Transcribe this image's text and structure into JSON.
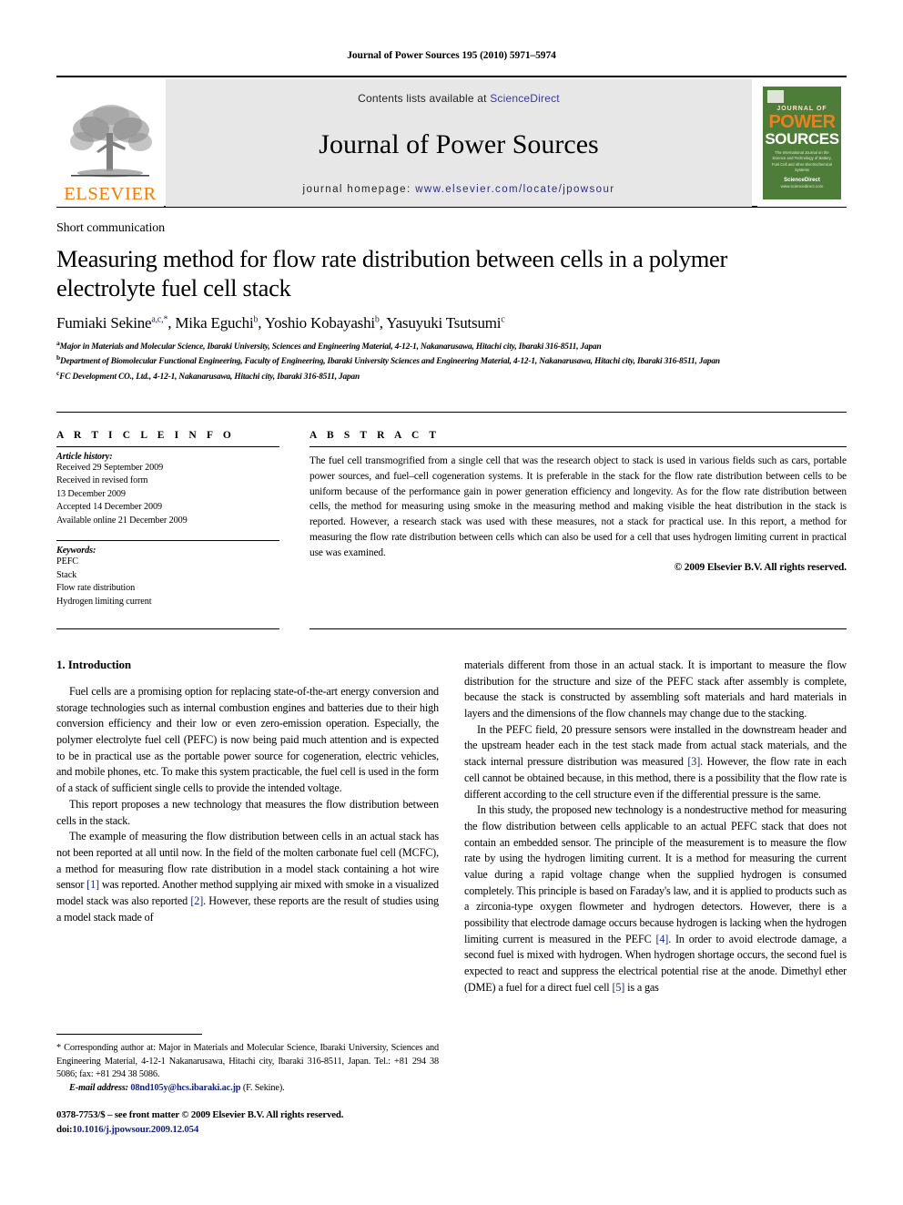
{
  "running_head": "Journal of Power Sources 195 (2010) 5971–5974",
  "masthead": {
    "publisher": "ELSEVIER",
    "contents_prefix": "Contents lists available at ",
    "contents_link": "ScienceDirect",
    "journal_name": "Journal of Power Sources",
    "homepage_prefix": "journal homepage: ",
    "homepage_url": "www.elsevier.com/locate/jpowsour",
    "cover": {
      "kicker": "JOURNAL OF",
      "title_line1": "POWER",
      "title_line2": "SOURCES",
      "subtitle": "The International Journal on the Science and Technology of Battery, Fuel Cell and other Electrochemical Systems",
      "footer_brand": "ScienceDirect",
      "footer_note": "www.sciencedirect.com"
    },
    "accent_orange": "#f07d00",
    "link_blue": "#2b2b8f",
    "banner_bg": "#e7e7e7",
    "cover_green": "#4e7d3a"
  },
  "article": {
    "category": "Short communication",
    "title": "Measuring method for flow rate distribution between cells in a polymer electrolyte fuel cell stack",
    "authors_html": "Fumiaki Sekine<sup>a,c,</sup><sup>*</sup>, Mika Eguchi<sup>b</sup>, Yoshio Kobayashi<sup>b</sup>, Yasuyuki Tsutsumi<sup>c</sup>",
    "affiliations": [
      {
        "marker": "a",
        "text": "Major in Materials and Molecular Science, Ibaraki University, Sciences and Engineering Material, 4-12-1, Nakanarusawa, Hitachi city, Ibaraki 316-8511, Japan"
      },
      {
        "marker": "b",
        "text": "Department of Biomolecular Functional Engineering, Faculty of Engineering, Ibaraki University Sciences and Engineering Material, 4-12-1, Nakanarusawa, Hitachi city, Ibaraki 316-8511, Japan"
      },
      {
        "marker": "c",
        "text": "FC Development CO., Ltd., 4-12-1, Nakanarusawa, Hitachi city, Ibaraki 316-8511, Japan"
      }
    ]
  },
  "info": {
    "heading": "A R T I C L E   I N F O",
    "history_label": "Article history:",
    "history": [
      "Received 29 September 2009",
      "Received in revised form",
      "13 December 2009",
      "Accepted 14 December 2009",
      "Available online 21 December 2009"
    ],
    "keywords_label": "Keywords:",
    "keywords": [
      "PEFC",
      "Stack",
      "Flow rate distribution",
      "Hydrogen limiting current"
    ]
  },
  "abstract": {
    "heading": "A B S T R A C T",
    "text": "The fuel cell transmogrified from a single cell that was the research object to stack is used in various fields such as cars, portable power sources, and fuel–cell cogeneration systems. It is preferable in the stack for the flow rate distribution between cells to be uniform because of the performance gain in power generation efficiency and longevity. As for the flow rate distribution between cells, the method for measuring using smoke in the measuring method and making visible the heat distribution in the stack is reported. However, a research stack was used with these measures, not a stack for practical use. In this report, a method for measuring the flow rate distribution between cells which can also be used for a cell that uses hydrogen limiting current in practical use was examined.",
    "copyright": "© 2009 Elsevier B.V. All rights reserved."
  },
  "body": {
    "section_heading": "1.  Introduction",
    "left_paragraphs": [
      "Fuel cells are a promising option for replacing state-of-the-art energy conversion and storage technologies such as internal combustion engines and batteries due to their high conversion efficiency and their low or even zero-emission operation. Especially, the polymer electrolyte fuel cell (PEFC) is now being paid much attention and is expected to be in practical use as the portable power source for cogeneration, electric vehicles, and mobile phones, etc. To make this system practicable, the fuel cell is used in the form of a stack of sufficient single cells to provide the intended voltage.",
      "This report proposes a new technology that measures the flow distribution between cells in the stack."
    ],
    "left_paragraph_3_parts": [
      "The example of measuring the flow distribution between cells in an actual stack has not been reported at all until now. In the field of the molten carbonate fuel cell (MCFC), a method for measuring flow rate distribution in a model stack containing a hot wire sensor ",
      "[1]",
      " was reported. Another method supplying air mixed with smoke in a visualized model stack was also reported ",
      "[2]",
      ". However, these reports are the result of studies using a model stack made of"
    ],
    "right_paragraph_1": "materials different from those in an actual stack. It is important to measure the flow distribution for the structure and size of the PEFC stack after assembly is complete, because the stack is constructed by assembling soft materials and hard materials in layers and the dimensions of the flow channels may change due to the stacking.",
    "right_paragraph_2_parts": [
      "In the PEFC field, 20 pressure sensors were installed in the downstream header and the upstream header each in the test stack made from actual stack materials, and the stack internal pressure distribution was measured ",
      "[3]",
      ". However, the flow rate in each cell cannot be obtained because, in this method, there is a possibility that the flow rate is different according to the cell structure even if the differential pressure is the same."
    ],
    "right_paragraph_3_parts": [
      "In this study, the proposed new technology is a nondestructive method for measuring the flow distribution between cells applicable to an actual PEFC stack that does not contain an embedded sensor. The principle of the measurement is to measure the flow rate by using the hydrogen limiting current. It is a method for measuring the current value during a rapid voltage change when the supplied hydrogen is consumed completely. This principle is based on Faraday's law, and it is applied to products such as a zirconia-type oxygen flowmeter and hydrogen detectors. However, there is a possibility that electrode damage occurs because hydrogen is lacking when the hydrogen limiting current is measured in the PEFC ",
      "[4]",
      ". In order to avoid electrode damage, a second fuel is mixed with hydrogen. When hydrogen shortage occurs, the second fuel is expected to react and suppress the electrical potential rise at the anode. Dimethyl ether (DME) a fuel for a direct fuel cell ",
      "[5]",
      " is a gas"
    ]
  },
  "footnote": {
    "corresponding": "* Corresponding author at: Major in Materials and Molecular Science, Ibaraki University, Sciences and Engineering Material, 4-12-1 Nakanarusawa, Hitachi city, Ibaraki 316-8511, Japan. Tel.: +81 294 38 5086; fax: +81 294 38 5086.",
    "email_label": "E-mail address:",
    "email": "08nd105y@hcs.ibaraki.ac.jp",
    "email_attrib": "(F. Sekine).",
    "issn_line": "0378-7753/$ – see front matter © 2009 Elsevier B.V. All rights reserved.",
    "doi_label": "doi:",
    "doi_value": "10.1016/j.jpowsour.2009.12.054"
  }
}
